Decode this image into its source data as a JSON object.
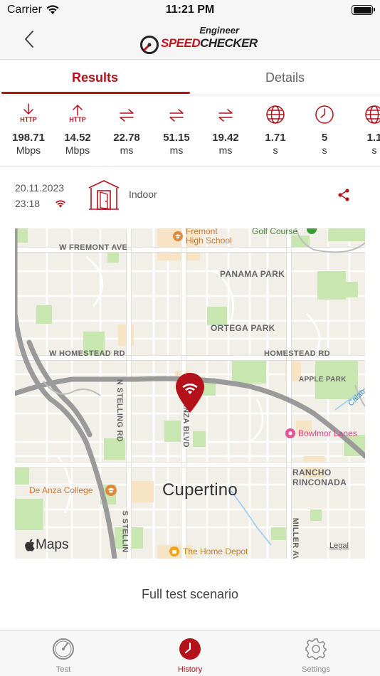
{
  "status_bar": {
    "carrier": "Carrier",
    "time": "11:21 PM"
  },
  "header": {
    "logo_engineer": "Engineer",
    "logo_speed": "SPEED",
    "logo_checker": "CHECKER"
  },
  "tabs": [
    {
      "label": "Results",
      "active": true
    },
    {
      "label": "Details",
      "active": false
    }
  ],
  "metrics": [
    {
      "icon": "http-download-icon",
      "icon_label": "HTTP",
      "value": "198.71",
      "unit": "Mbps"
    },
    {
      "icon": "http-upload-icon",
      "icon_label": "HTTP",
      "value": "14.52",
      "unit": "Mbps"
    },
    {
      "icon": "latency-arrows-icon",
      "value": "22.78",
      "unit": "ms"
    },
    {
      "icon": "latency-arrows-icon",
      "value": "51.15",
      "unit": "ms"
    },
    {
      "icon": "latency-arrows-icon",
      "value": "19.42",
      "unit": "ms"
    },
    {
      "icon": "globe-icon",
      "value": "1.71",
      "unit": "s"
    },
    {
      "icon": "clock-icon",
      "value": "5",
      "unit": "s"
    },
    {
      "icon": "globe-icon",
      "value": "1.1",
      "unit": "s"
    }
  ],
  "test_info": {
    "date": "20.11.2023",
    "time": "23:18",
    "location_type": "Indoor"
  },
  "map": {
    "streets": {
      "fremont": "W FREMONT AVE",
      "homestead_w": "W HOMESTEAD RD",
      "homestead": "HOMESTEAD RD",
      "stelling_n": "N STELLING RD",
      "stelling_s": "S STELLIN",
      "de_anza": "DE ANZA BLVD",
      "miller": "MILLER AVE"
    },
    "areas": {
      "panama_park": "PANAMA PARK",
      "ortega_park": "ORTEGA PARK",
      "apple_park": "APPLE PARK",
      "rancho_rinconada": "RANCHO RINCONADA"
    },
    "pois": {
      "fremont_high": "Fremont High School",
      "golf_course": "Golf Course",
      "de_anza_college": "De Anza College",
      "home_depot": "The Home Depot",
      "bowlmor": "Bowlmor Lanes",
      "calabazas": "Calab"
    },
    "city": "Cupertino",
    "attribution": "Maps",
    "legal": "Legal"
  },
  "scenario_label": "Full test scenario",
  "tab_bar": [
    {
      "label": "Test",
      "icon": "gauge-icon"
    },
    {
      "label": "History",
      "icon": "history-clock-icon"
    },
    {
      "label": "Settings",
      "icon": "gear-icon"
    }
  ],
  "colors": {
    "brand_red": "#b3121b",
    "map_background": "#f2efe9",
    "park_green": "#c7e6b0"
  }
}
